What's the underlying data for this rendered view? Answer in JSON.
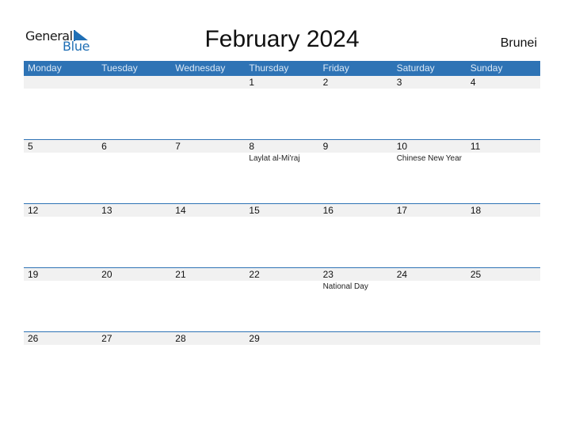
{
  "logo": {
    "general": "General",
    "blue": "Blue",
    "icon": "triangle-flag-icon"
  },
  "title": "February 2024",
  "country": "Brunei",
  "weekdays": [
    "Monday",
    "Tuesday",
    "Wednesday",
    "Thursday",
    "Friday",
    "Saturday",
    "Sunday"
  ],
  "weeks": [
    {
      "days": [
        {
          "num": "",
          "event": ""
        },
        {
          "num": "",
          "event": ""
        },
        {
          "num": "",
          "event": ""
        },
        {
          "num": "1",
          "event": ""
        },
        {
          "num": "2",
          "event": ""
        },
        {
          "num": "3",
          "event": ""
        },
        {
          "num": "4",
          "event": ""
        }
      ]
    },
    {
      "days": [
        {
          "num": "5",
          "event": ""
        },
        {
          "num": "6",
          "event": ""
        },
        {
          "num": "7",
          "event": ""
        },
        {
          "num": "8",
          "event": "Laylat al-Mi'raj"
        },
        {
          "num": "9",
          "event": ""
        },
        {
          "num": "10",
          "event": "Chinese New Year"
        },
        {
          "num": "11",
          "event": ""
        }
      ]
    },
    {
      "days": [
        {
          "num": "12",
          "event": ""
        },
        {
          "num": "13",
          "event": ""
        },
        {
          "num": "14",
          "event": ""
        },
        {
          "num": "15",
          "event": ""
        },
        {
          "num": "16",
          "event": ""
        },
        {
          "num": "17",
          "event": ""
        },
        {
          "num": "18",
          "event": ""
        }
      ]
    },
    {
      "days": [
        {
          "num": "19",
          "event": ""
        },
        {
          "num": "20",
          "event": ""
        },
        {
          "num": "21",
          "event": ""
        },
        {
          "num": "22",
          "event": ""
        },
        {
          "num": "23",
          "event": "National Day"
        },
        {
          "num": "24",
          "event": ""
        },
        {
          "num": "25",
          "event": ""
        }
      ]
    },
    {
      "days": [
        {
          "num": "26",
          "event": ""
        },
        {
          "num": "27",
          "event": ""
        },
        {
          "num": "28",
          "event": ""
        },
        {
          "num": "29",
          "event": ""
        },
        {
          "num": "",
          "event": ""
        },
        {
          "num": "",
          "event": ""
        },
        {
          "num": "",
          "event": ""
        }
      ]
    }
  ],
  "colors": {
    "accent": "#2e73b5",
    "band": "#f1f1f1",
    "logo_blue": "#1f6fb5"
  }
}
